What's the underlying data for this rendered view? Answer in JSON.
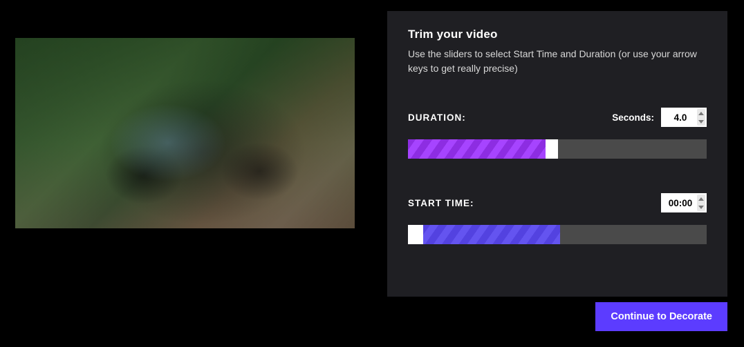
{
  "panel": {
    "title": "Trim your video",
    "description": "Use the sliders to select Start Time and Duration (or use your arrow keys to get really precise)",
    "duration": {
      "label": "DURATION:",
      "unit": "Seconds:",
      "value": "4.0",
      "fill_percent": 46
    },
    "start_time": {
      "label": "START TIME:",
      "value": "00:00",
      "handle_percent": 0,
      "fill_percent": 46
    }
  },
  "footer": {
    "continue_label": "Continue to Decorate"
  }
}
